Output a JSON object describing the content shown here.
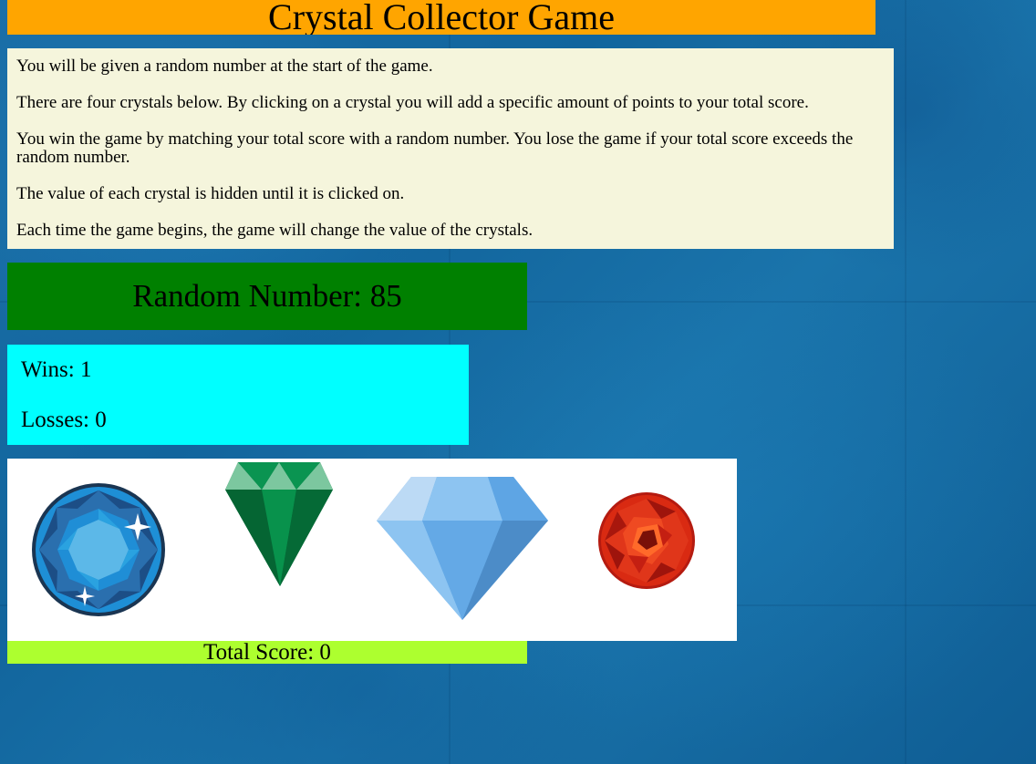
{
  "header": {
    "title": "Crystal Collector Game"
  },
  "instructions": [
    "You will be given a random number at the start of the game.",
    "There are four crystals below. By clicking on a crystal you will add a specific amount of points to your total score.",
    "You win the game by matching your total score with a random number. You lose the game if your total score exceeds the random number.",
    "The value of each crystal is hidden until it is clicked on.",
    "Each time the game begins, the game will change the value of the crystals."
  ],
  "random_number": {
    "label": "Random Number: 85",
    "value": 85
  },
  "stats": {
    "wins_label": "Wins: 1",
    "wins": 1,
    "losses_label": "Losses: 0",
    "losses": 0
  },
  "crystals": [
    {
      "name": "blue-round-crystal-icon",
      "color": "#1e8fd6"
    },
    {
      "name": "green-crystal-icon",
      "color": "#078a48"
    },
    {
      "name": "light-blue-diamond-icon",
      "color": "#64a9e6"
    },
    {
      "name": "red-round-crystal-icon",
      "color": "#d92a12"
    }
  ],
  "total_score": {
    "label": "Total Score: 0",
    "value": 0
  },
  "colors": {
    "title_bg": "#ffa500",
    "instructions_bg": "#f5f5dc",
    "random_bg": "#008000",
    "stats_bg": "#00ffff",
    "crystal_panel_bg": "#ffffff",
    "score_bg": "#adff2f"
  }
}
